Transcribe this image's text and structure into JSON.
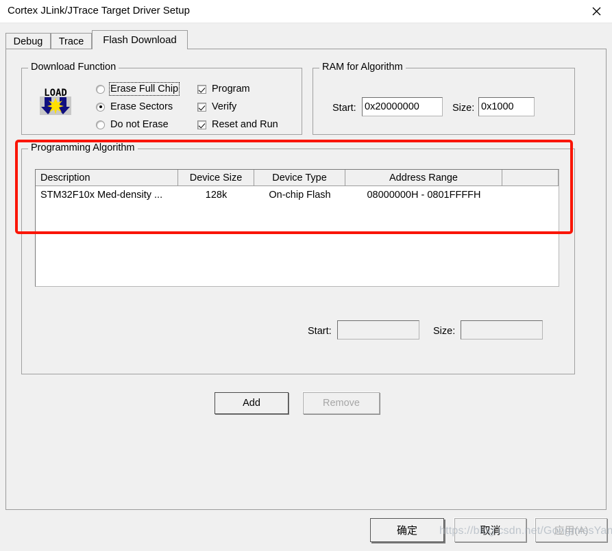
{
  "window": {
    "title": "Cortex JLink/JTrace Target Driver Setup",
    "close_icon": "close-icon"
  },
  "tabs": [
    {
      "label": "Debug",
      "active": false
    },
    {
      "label": "Trace",
      "active": false
    },
    {
      "label": "Flash Download",
      "active": true
    }
  ],
  "download_function": {
    "legend": "Download Function",
    "icon": "load-icon",
    "radios": [
      {
        "label": "Erase Full Chip",
        "checked": false,
        "focused": true
      },
      {
        "label": "Erase Sectors",
        "checked": true,
        "focused": false
      },
      {
        "label": "Do not Erase",
        "checked": false,
        "focused": false
      }
    ],
    "checkboxes": [
      {
        "label": "Program",
        "checked": true
      },
      {
        "label": "Verify",
        "checked": true
      },
      {
        "label": "Reset and Run",
        "checked": true
      }
    ]
  },
  "ram_for_algorithm": {
    "legend": "RAM for Algorithm",
    "start_label": "Start:",
    "start_value": "0x20000000",
    "size_label": "Size:",
    "size_value": "0x1000"
  },
  "programming_algorithm": {
    "legend": "Programming Algorithm",
    "columns": [
      "Description",
      "Device Size",
      "Device Type",
      "Address Range",
      ""
    ],
    "rows": [
      {
        "description": "STM32F10x Med-density ...",
        "device_size": "128k",
        "device_type": "On-chip Flash",
        "address_range": "08000000H - 0801FFFFH",
        "extra": ""
      }
    ],
    "start_label": "Start:",
    "start_value": "",
    "size_label": "Size:",
    "size_value": "",
    "highlight_color": "#fa1505"
  },
  "actions": {
    "add_label": "Add",
    "remove_label": "Remove",
    "remove_disabled": true
  },
  "dialog_buttons": {
    "ok_label": "确定",
    "cancel_label": "取消",
    "apply_label": "应用(A)",
    "apply_disabled": true
  },
  "watermark": {
    "text": "https://blog.csdn.net/GongmissYan"
  }
}
